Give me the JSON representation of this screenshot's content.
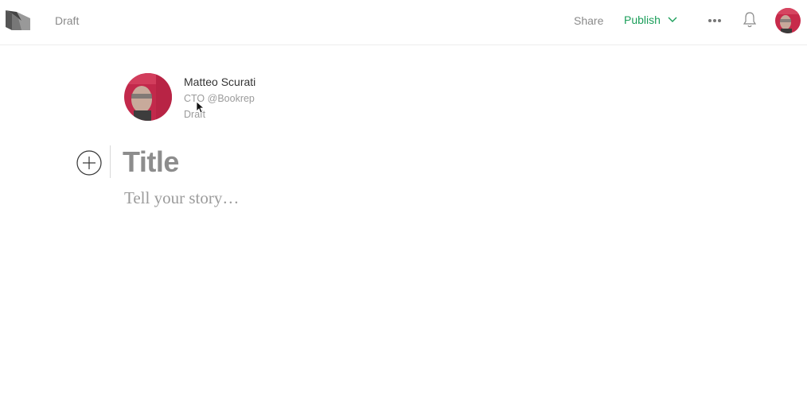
{
  "header": {
    "logo_icon": "medium-logo-icon",
    "status": "Draft",
    "share_label": "Share",
    "publish_label": "Publish",
    "more_icon": "more-dots-icon",
    "notifications_icon": "bell-icon",
    "accent_color": "#1b9e5a"
  },
  "author": {
    "name": "Matteo Scurati",
    "bio": "CTO @Bookrep",
    "status": "Draft"
  },
  "editor": {
    "add_icon": "plus-circle-icon",
    "title_placeholder": "Title",
    "story_placeholder": "Tell your story…"
  }
}
